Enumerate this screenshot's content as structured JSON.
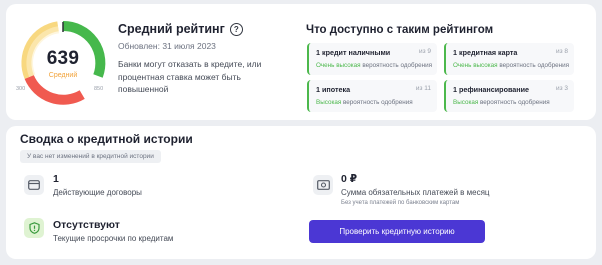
{
  "rating": {
    "score": "639",
    "score_label": "Средний",
    "title": "Средний рейтинг",
    "updated": "Обновлен: 31 июля 2023",
    "description": "Банки могут отказать в кредите, или процентная ставка может быть повышенной",
    "gauge_ticks": {
      "left": "300",
      "right": "850"
    },
    "colors": {
      "bad": "#f05a50",
      "medium": "#f8d880",
      "good": "#46b84c"
    }
  },
  "available": {
    "title": "Что доступно с таким рейтингом",
    "tiles": [
      {
        "name": "1 кредит наличными",
        "count": "из 9",
        "prob_prefix": "Очень высокая",
        "prob_suffix": " вероятность одобрения"
      },
      {
        "name": "1 кредитная карта",
        "count": "из 8",
        "prob_prefix": "Очень высокая",
        "prob_suffix": " вероятность одобрения"
      },
      {
        "name": "1 ипотека",
        "count": "из 11",
        "prob_prefix": "Высокая",
        "prob_suffix": " вероятность одобрения"
      },
      {
        "name": "1 рефинансирование",
        "count": "из 3",
        "prob_prefix": "Высокая",
        "prob_suffix": " вероятность одобрения"
      }
    ]
  },
  "history": {
    "title": "Сводка о кредитной истории",
    "no_changes": "У вас нет изменений в кредитной истории",
    "contracts_value": "1",
    "contracts_label": "Действующие договоры",
    "payments_value": "0 ₽",
    "payments_label": "Сумма обязательных платежей в месяц",
    "payments_note": "Без учета платежей по банковским картам",
    "overdue_value": "Отсутствуют",
    "overdue_label": "Текущие просрочки по кредитам",
    "check_button": "Проверить кредитную историю"
  }
}
